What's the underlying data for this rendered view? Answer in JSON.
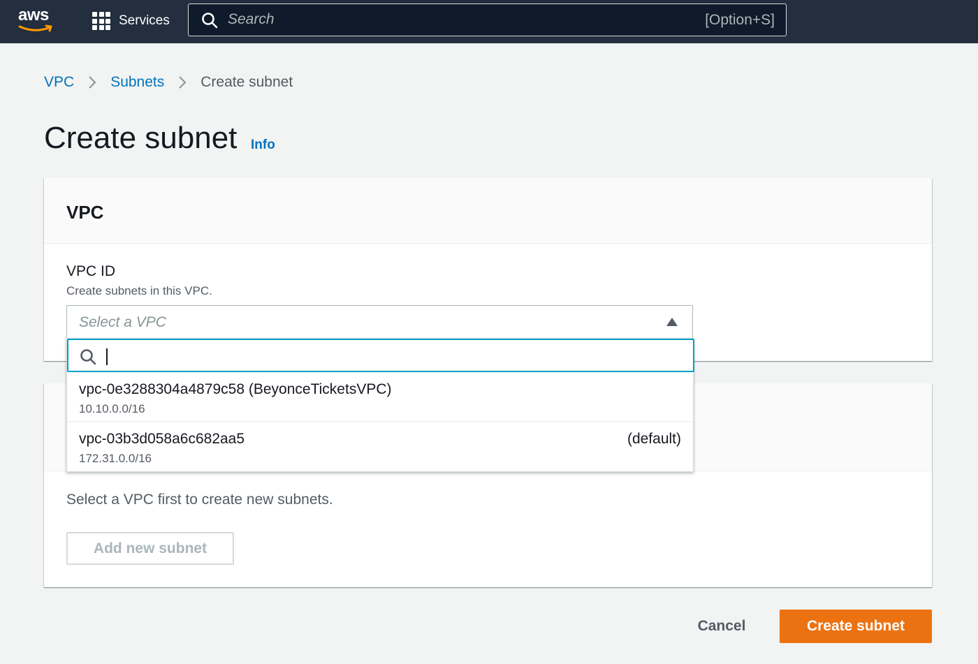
{
  "topbar": {
    "logo_text": "aws",
    "services_label": "Services",
    "search_placeholder": "Search",
    "search_shortcut": "[Option+S]"
  },
  "breadcrumb": {
    "items": [
      "VPC",
      "Subnets",
      "Create subnet"
    ]
  },
  "page": {
    "title": "Create subnet",
    "info_link": "Info"
  },
  "vpc_section": {
    "header": "VPC",
    "field_label": "VPC ID",
    "field_description": "Create subnets in this VPC.",
    "select_placeholder": "Select a VPC",
    "dropdown_search_value": "",
    "options": [
      {
        "id": "vpc-0e3288304a4879c58 (BeyonceTicketsVPC)",
        "cidr": "10.10.0.0/16",
        "tag": ""
      },
      {
        "id": "vpc-03b3d058a6c682aa5",
        "cidr": "172.31.0.0/16",
        "tag": "(default)"
      }
    ]
  },
  "subnet_section": {
    "message": "Select a VPC first to create new subnets.",
    "add_button_label": "Add new subnet"
  },
  "footer": {
    "cancel_label": "Cancel",
    "create_label": "Create subnet"
  },
  "colors": {
    "nav_bg": "#232f3e",
    "link": "#0073bb",
    "primary_button": "#ec7211",
    "focus_ring": "#00a1c9",
    "aws_smile": "#ff9900"
  },
  "icons": {
    "logo": "aws-logo",
    "services": "grid-icon",
    "search": "search-icon",
    "breadcrumb_separator": "chevron-right-icon",
    "select_caret": "caret-up-icon"
  }
}
